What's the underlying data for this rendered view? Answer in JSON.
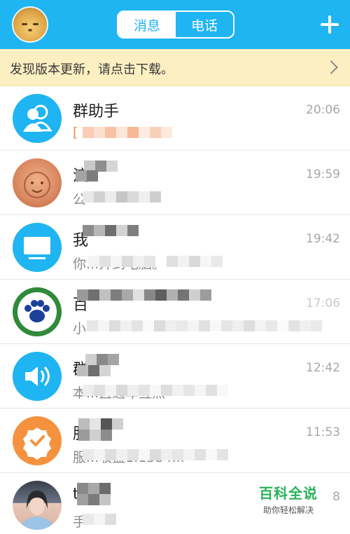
{
  "header": {
    "tabs": [
      {
        "label": "消息",
        "active": true
      },
      {
        "label": "电话",
        "active": false
      }
    ],
    "add_icon": "plus-icon",
    "accent_color": "#1fb4f2"
  },
  "notice": {
    "text": "发现版本更新，请点击下载。",
    "icon": "chevron-right-icon"
  },
  "conversations": [
    {
      "name": "群助手",
      "preview": "[",
      "time": "20:06",
      "avatar_icon": "group-people-icon"
    },
    {
      "name": "流",
      "preview": "公",
      "time": "19:59",
      "avatar_icon": "photo-avatar"
    },
    {
      "name": "我",
      "preview": "你...并到电脑。",
      "time": "19:42",
      "avatar_icon": "monitor-icon"
    },
    {
      "name": "百",
      "preview": "小",
      "time": "17:06",
      "avatar_icon": "paw-logo"
    },
    {
      "name": "群",
      "preview": "本...直通车互点",
      "time": "12:42",
      "avatar_icon": "speaker-icon"
    },
    {
      "name": "服",
      "preview": "服...收益1.1584...",
      "time": "11:53",
      "avatar_icon": "badge-check-icon"
    },
    {
      "name": "t",
      "preview": "手",
      "time": "8",
      "avatar_icon": "photo-avatar"
    }
  ],
  "watermark": {
    "title": "百科全说",
    "subtitle": "助你轻松解决"
  }
}
